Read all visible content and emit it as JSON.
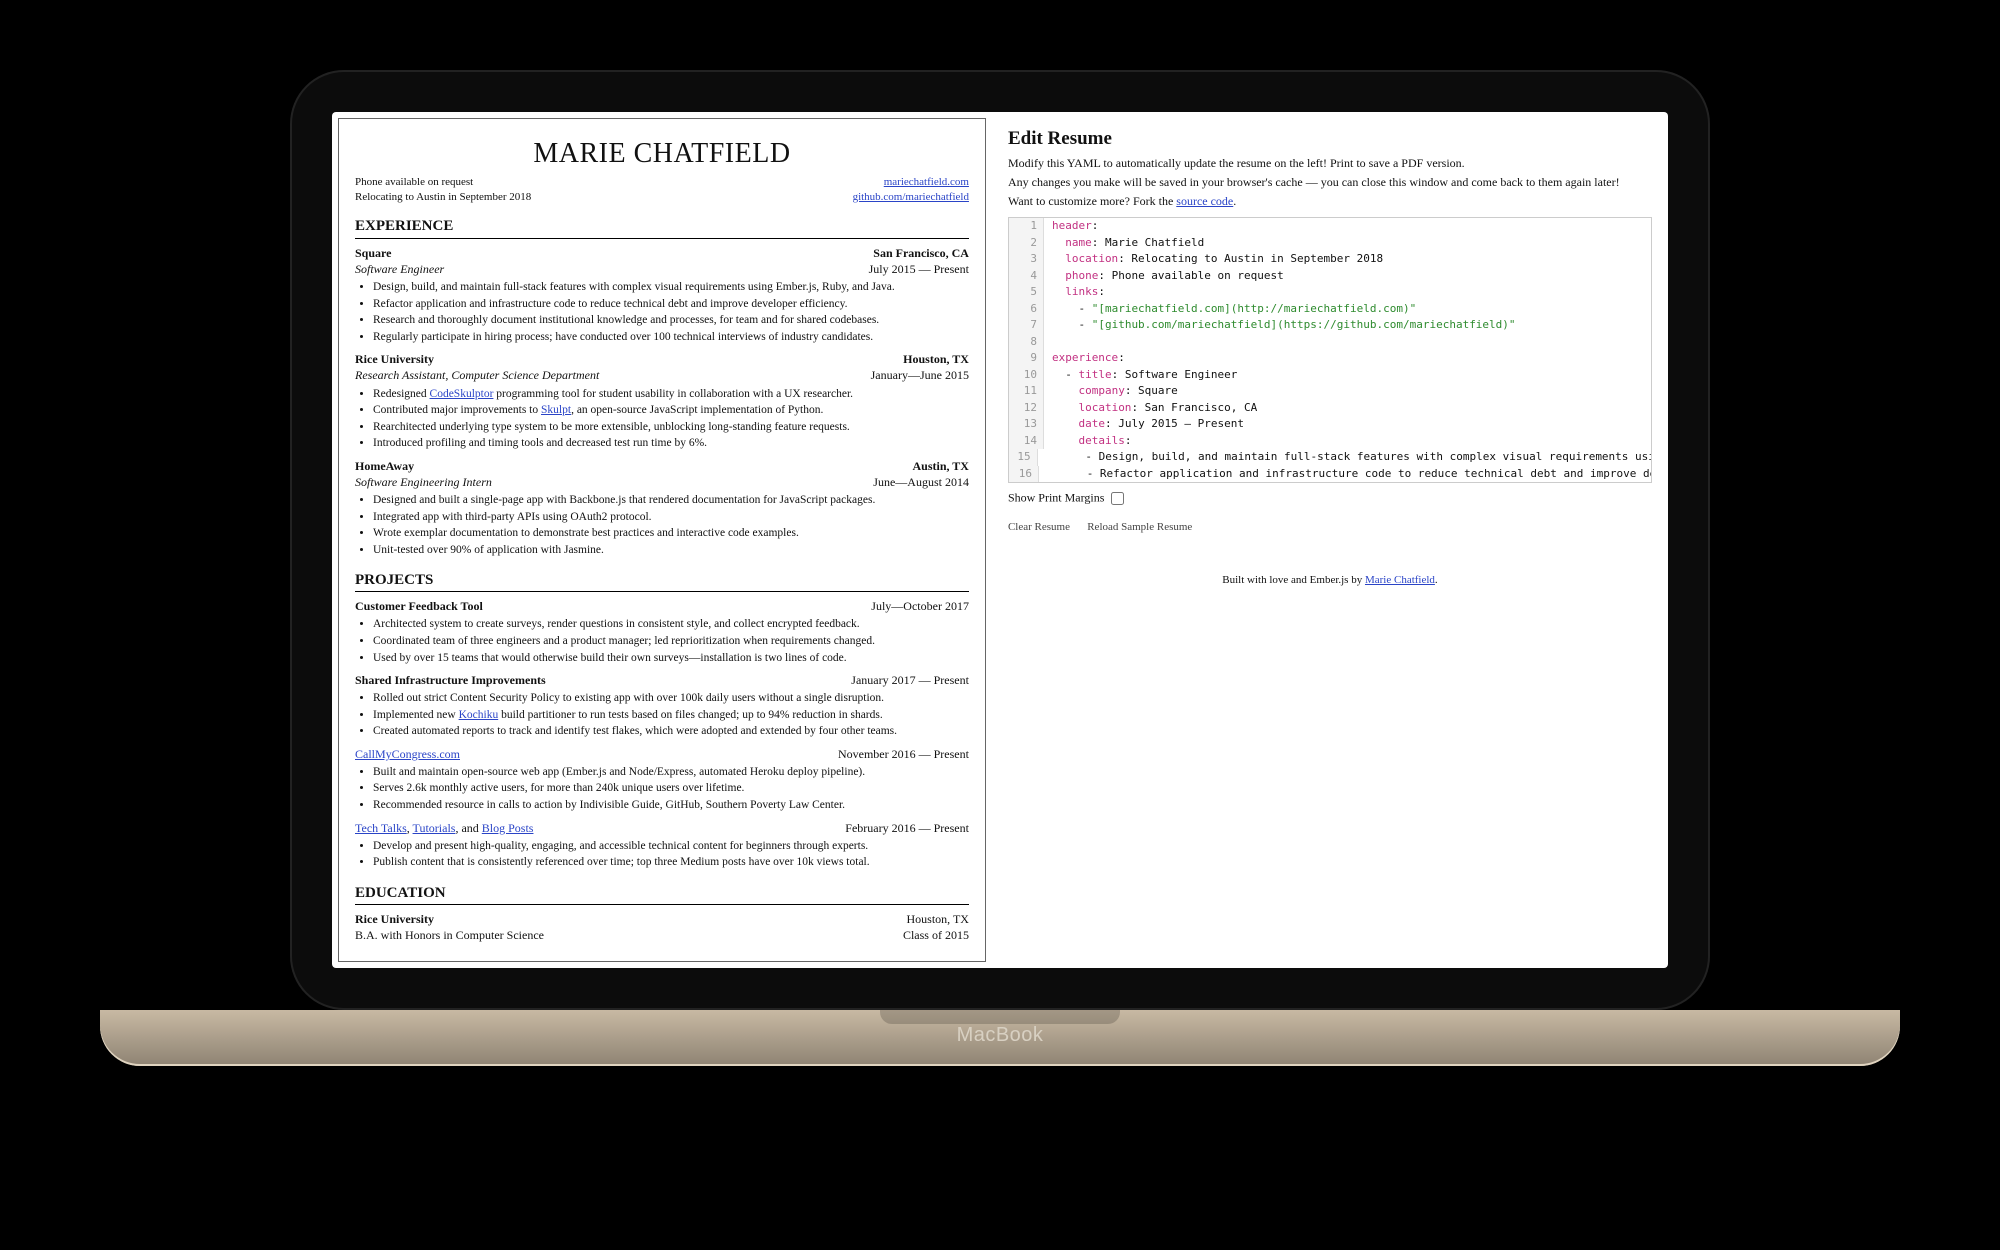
{
  "resume": {
    "name": "MARIE CHATFIELD",
    "phone_line": "Phone available on request",
    "location_line": "Relocating to Austin in September 2018",
    "link1": "mariechatfield.com",
    "link2": "github.com/mariechatfield",
    "sections": {
      "experience": {
        "title": "EXPERIENCE",
        "entries": [
          {
            "org": "Square",
            "loc": "San Francisco, CA",
            "role": "Software Engineer",
            "date": "July 2015 — Present",
            "bullets": [
              "Design, build, and maintain full-stack features with complex visual requirements using Ember.js, Ruby, and Java.",
              "Refactor application and infrastructure code to reduce technical debt and improve developer efficiency.",
              "Research and thoroughly document institutional knowledge and processes, for team and for shared codebases.",
              "Regularly participate in hiring process; have conducted over 100 technical interviews of industry candidates."
            ]
          },
          {
            "org": "Rice University",
            "loc": "Houston, TX",
            "role": "Research Assistant, Computer Science Department",
            "date": "January—June 2015",
            "bullets_html": [
              "Redesigned <a class='inl' data-name='link-codeskulptor' data-interactable='true'>CodeSkulptor</a> programming tool for student usability in collaboration with a UX researcher.",
              "Contributed major improvements to <a class='inl' data-name='link-skulpt' data-interactable='true'>Skulpt</a>, an open-source JavaScript implementation of Python.",
              "Rearchitected underlying type system to be more extensible, unblocking long-standing feature requests.",
              "Introduced profiling and timing tools and decreased test run time by 6%."
            ]
          },
          {
            "org": "HomeAway",
            "loc": "Austin, TX",
            "role": "Software Engineering Intern",
            "date": "June—August 2014",
            "bullets": [
              "Designed and built a single-page app with Backbone.js that rendered documentation for JavaScript packages.",
              "Integrated app with third-party APIs using OAuth2 protocol.",
              "Wrote exemplar documentation to demonstrate best practices and interactive code examples.",
              "Unit-tested over 90% of application with Jasmine."
            ]
          }
        ]
      },
      "projects": {
        "title": "PROJECTS",
        "entries": [
          {
            "org": "Customer Feedback Tool",
            "date": "July—October 2017",
            "bullets": [
              "Architected system to create surveys, render questions in consistent style, and collect encrypted feedback.",
              "Coordinated team of three engineers and a product manager; led reprioritization when requirements changed.",
              "Used by over 15 teams that would otherwise build their own surveys—installation is two lines of code."
            ]
          },
          {
            "org": "Shared Infrastructure Improvements",
            "date": "January 2017 — Present",
            "bullets_html": [
              "Rolled out strict Content Security Policy to existing app with over 100k daily users without a single disruption.",
              "Implemented new <a class='inl' data-name='link-kochiku' data-interactable='true'>Kochiku</a> build partitioner to run tests based on files changed; up to 94% reduction in shards.",
              "Created automated reports to track and identify test flakes, which were adopted and extended by four other teams."
            ]
          },
          {
            "org_link": "CallMyCongress.com",
            "date": "November 2016 — Present",
            "bullets": [
              "Built and maintain open-source web app (Ember.js and Node/Express, automated Heroku deploy pipeline).",
              "Serves 2.6k monthly active users, for more than 240k unique users over lifetime.",
              "Recommended resource in calls to action by Indivisible Guide, GitHub, Southern Poverty Law Center."
            ]
          },
          {
            "org_multi": {
              "a": "Tech Talks",
              "sep1": ", ",
              "b": "Tutorials",
              "sep2": ", and ",
              "c": "Blog Posts"
            },
            "date": "February 2016 — Present",
            "bullets": [
              "Develop and present high-quality, engaging, and accessible technical content for beginners through experts.",
              "Publish content that is consistently referenced over time; top three Medium posts have over 10k views total."
            ]
          }
        ]
      },
      "education": {
        "title": "EDUCATION",
        "entry": {
          "org": "Rice University",
          "loc": "Houston, TX",
          "line2l": "B.A. with Honors in Computer Science",
          "line2r": "Class of 2015"
        }
      }
    }
  },
  "editor": {
    "title": "Edit Resume",
    "p1": "Modify this YAML to automatically update the resume on the left! Print to save a PDF version.",
    "p2": "Any changes you make will be saved in your browser's cache — you can close this window and come back to them again later!",
    "p3_pre": "Want to customize more? Fork the ",
    "p3_link": "source code",
    "p3_post": ".",
    "show_margins_label": "Show Print Margins",
    "clear_btn": "Clear Resume",
    "reload_btn": "Reload Sample Resume",
    "credit_pre": "Built with love and Ember.js by ",
    "credit_link": "Marie Chatfield",
    "credit_post": ".",
    "code_lines": [
      [
        {
          "t": "header",
          "c": "kw"
        },
        {
          "t": ":"
        }
      ],
      [
        {
          "t": "  "
        },
        {
          "t": "name",
          "c": "kw"
        },
        {
          "t": ": Marie Chatfield"
        }
      ],
      [
        {
          "t": "  "
        },
        {
          "t": "location",
          "c": "kw"
        },
        {
          "t": ": Relocating to Austin in September 2018"
        }
      ],
      [
        {
          "t": "  "
        },
        {
          "t": "phone",
          "c": "kw"
        },
        {
          "t": ": Phone available on request"
        }
      ],
      [
        {
          "t": "  "
        },
        {
          "t": "links",
          "c": "kw"
        },
        {
          "t": ":"
        }
      ],
      [
        {
          "t": "    - "
        },
        {
          "t": "\"[mariechatfield.com](http://mariechatfield.com)\"",
          "c": "str"
        }
      ],
      [
        {
          "t": "    - "
        },
        {
          "t": "\"[github.com/mariechatfield](https://github.com/mariechatfield)\"",
          "c": "str"
        }
      ],
      [
        {
          "t": ""
        }
      ],
      [
        {
          "t": "experience",
          "c": "kw"
        },
        {
          "t": ":"
        }
      ],
      [
        {
          "t": "  - "
        },
        {
          "t": "title",
          "c": "kw"
        },
        {
          "t": ": Software Engineer"
        }
      ],
      [
        {
          "t": "    "
        },
        {
          "t": "company",
          "c": "kw"
        },
        {
          "t": ": Square"
        }
      ],
      [
        {
          "t": "    "
        },
        {
          "t": "location",
          "c": "kw"
        },
        {
          "t": ": San Francisco, CA"
        }
      ],
      [
        {
          "t": "    "
        },
        {
          "t": "date",
          "c": "kw"
        },
        {
          "t": ": July 2015 — Present"
        }
      ],
      [
        {
          "t": "    "
        },
        {
          "t": "details",
          "c": "kw"
        },
        {
          "t": ":"
        }
      ],
      [
        {
          "t": "      - Design, build, and maintain full-stack features with complex visual requirements using Ember.js, Ruby, and Jav"
        }
      ],
      [
        {
          "t": "      - Refactor application and infrastructure code to reduce technical debt and improve developer efficiency."
        }
      ]
    ]
  },
  "brand": "MacBook"
}
